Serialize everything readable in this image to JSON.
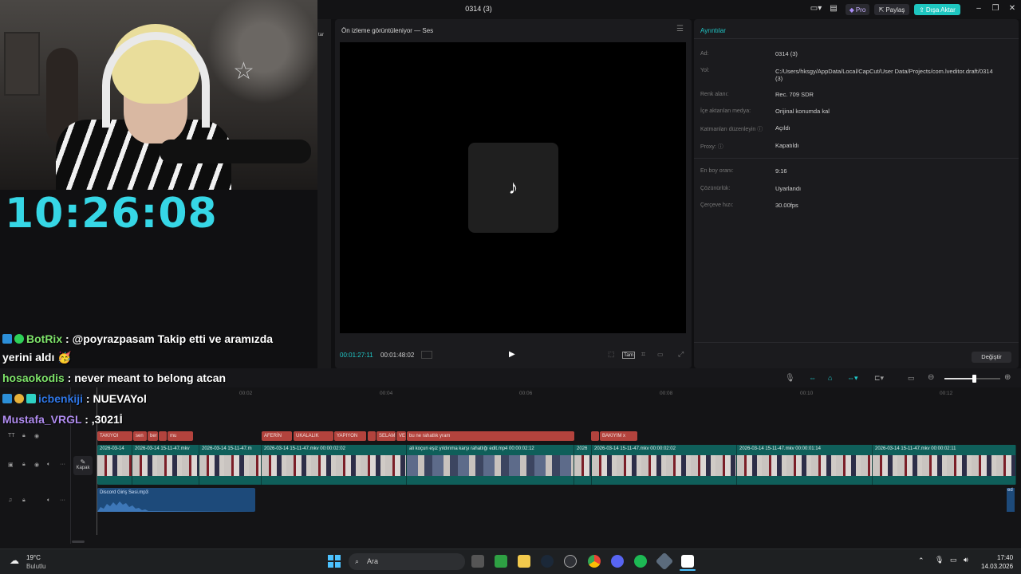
{
  "window": {
    "title": "0314 (3)",
    "pro_label": "Pro",
    "share_label": "Paylaş",
    "export_label": "Dışa Aktar",
    "left_fragment": "tar"
  },
  "clock": "10:26:08",
  "chat": [
    {
      "user": "BotRix",
      "user_color": "#7ee36a",
      "text": " : @poyrazpasam Takip etti ve aramızda",
      "badge_colors": [
        "#2c8fd8",
        "#2ed158"
      ]
    },
    {
      "user": "",
      "user_color": "#ffffff",
      "text": "yerini aldı 🥳",
      "badge_colors": []
    },
    {
      "user": "hosaokodis",
      "user_color": "#7ee36a",
      "text": " : never meant to belong atcan",
      "badge_colors": []
    },
    {
      "user": "icbenkiji",
      "user_color": "#2f77e8",
      "text": " : NUEVAYol",
      "badge_colors": [
        "#2c8fd8",
        "#e8b23a",
        "#2ed1c4"
      ]
    },
    {
      "user": "Mustafa_VRGL",
      "user_color": "#b08cf0",
      "text": " : ,3021İ",
      "badge_colors": []
    }
  ],
  "preview": {
    "title": "Ön izleme görüntüleniyor — Ses",
    "current_time": "00:01:27:11",
    "total_time": "00:01:48:02",
    "tam_label": "Tam"
  },
  "details": {
    "title": "Ayrıntılar",
    "rows": [
      {
        "label": "Ad:",
        "value": "0314 (3)"
      },
      {
        "label": "Yol:",
        "value": "C:/Users/hksgy/AppData/Local/CapCut/User Data/Projects/com.lveditor.draft/0314"
      },
      {
        "label": "",
        "value": "(3)"
      },
      {
        "label": "Renk alanı:",
        "value": "Rec. 709 SDR"
      },
      {
        "label": "İçe aktarılan medya:",
        "value": "Orijinal konumda kal"
      },
      {
        "label": "Katmanları düzenleyin ⓘ",
        "value": "Açıldı"
      },
      {
        "label": "Proxy: ⓘ",
        "value": "Kapatıldı"
      },
      {
        "label": "En boy oranı:",
        "value": "9:16"
      },
      {
        "label": "Çözünürlük:",
        "value": "Uyarlandı"
      },
      {
        "label": "Çerçeve hızı:",
        "value": "30.00fps"
      }
    ],
    "change_button": "Değiştir"
  },
  "timeline": {
    "ticks": [
      "00:02",
      "00:04",
      "00:06",
      "00:08",
      "00:10",
      "00:12"
    ],
    "kapak_label": "Kapak",
    "text_clips": [
      "TAKIYOI",
      "sen",
      "ber",
      "",
      "mu",
      "AFERİN",
      "UKALALIK",
      "YAPIYON",
      "",
      "SELAM",
      "VE",
      "bu ne rahatlık yram",
      "",
      "BAKIYIM x"
    ],
    "video_clips": [
      "2026-03-14",
      "2026-03-14 15-11-47.mkv",
      "2026-03-14 15-11-47.m",
      "2026-03-14 15-11-47.mkv   00:00:02:02",
      "ali koçun eşiz yıldırıma karşı rahatlığı edit.mp4   00:00:02:12",
      "2026",
      "2026-03-14 15-11-47.mkv   00:00:02:02",
      "2026-03-14 15-11-47.mkv   00:00:01:14",
      "2026-03-14 15-11-47.mkv   00:00:02:11"
    ],
    "audio_clip": "Discord Giriş Sesi.mp3",
    "audio_edge": "ed"
  },
  "taskbar": {
    "weather_temp": "19°C",
    "weather_desc": "Bulutlu",
    "search_placeholder": "Ara",
    "time": "17:40",
    "date": "14.03.2026"
  },
  "colors": {
    "accent": "#20c8c8",
    "export_btn": "#1ec6c0",
    "clock": "#36d7e6",
    "text_clip": "#b3433d",
    "video_track": "#0f5f5a",
    "audio_track": "#1d4a7a"
  }
}
